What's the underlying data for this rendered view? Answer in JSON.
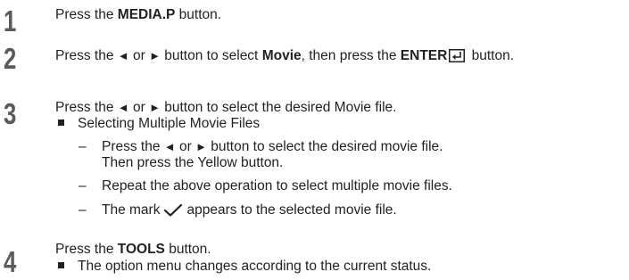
{
  "steps": [
    {
      "number": "1",
      "text_prefix": "Press the ",
      "text_bold": "MEDIA.P",
      "text_suffix": " button."
    },
    {
      "number": "2",
      "text_prefix": "Press the ",
      "left_arrow": "◄",
      "or_word": " or ",
      "right_arrow": "►",
      "text_mid": " button to select ",
      "bold_movie": "Movie",
      "text_mid2": ", then press the ",
      "bold_enter": "ENTER",
      "text_suffix": " button."
    },
    {
      "number": "3",
      "text_prefix": "Press the ",
      "left_arrow": "◄",
      "or_word": " or ",
      "right_arrow": "►",
      "text_suffix": " button to select the desired Movie file.",
      "bullet": "Selecting Multiple Movie Files",
      "subitems": {
        "first_prefix": "Press the ",
        "first_left_arrow": "◄",
        "first_or": " or ",
        "first_right_arrow": "►",
        "first_suffix": " button to select the desired movie file.",
        "first_cont": "Then press the Yellow button.",
        "second": "Repeat the above operation to select multiple movie files.",
        "third_prefix": "The mark",
        "third_suffix": "appears to the selected movie file."
      },
      "dash": "–"
    },
    {
      "number": "4",
      "text_prefix": "Press the ",
      "text_bold": "TOOLS",
      "text_suffix": " button.",
      "bullet": "The option menu changes according to the current status."
    }
  ],
  "icons": {
    "enter": "enter-icon",
    "check": "check-icon",
    "bullet": "square-bullet-icon"
  }
}
